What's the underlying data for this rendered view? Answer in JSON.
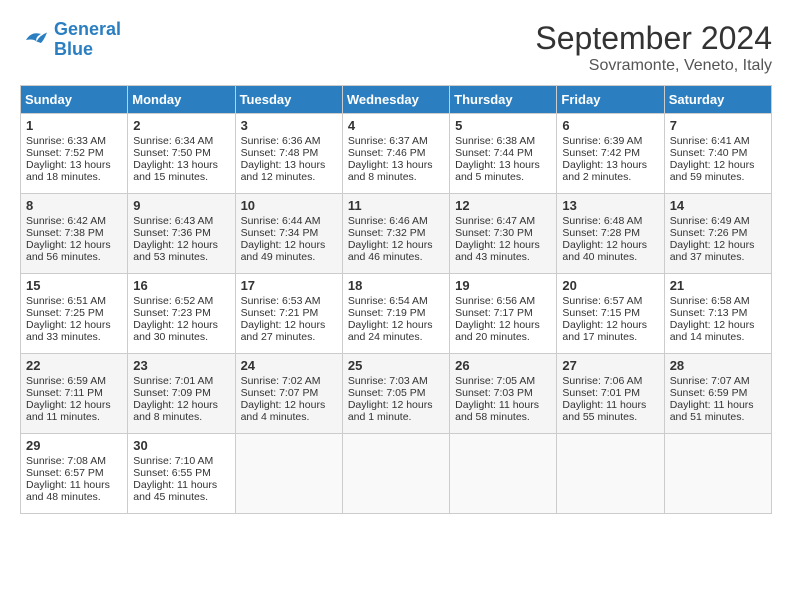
{
  "header": {
    "logo_line1": "General",
    "logo_line2": "Blue",
    "month": "September 2024",
    "location": "Sovramonte, Veneto, Italy"
  },
  "days_of_week": [
    "Sunday",
    "Monday",
    "Tuesday",
    "Wednesday",
    "Thursday",
    "Friday",
    "Saturday"
  ],
  "weeks": [
    [
      {
        "day": 1,
        "sunrise": "6:33 AM",
        "sunset": "7:52 PM",
        "daylight": "13 hours and 18 minutes."
      },
      {
        "day": 2,
        "sunrise": "6:34 AM",
        "sunset": "7:50 PM",
        "daylight": "13 hours and 15 minutes."
      },
      {
        "day": 3,
        "sunrise": "6:36 AM",
        "sunset": "7:48 PM",
        "daylight": "13 hours and 12 minutes."
      },
      {
        "day": 4,
        "sunrise": "6:37 AM",
        "sunset": "7:46 PM",
        "daylight": "13 hours and 8 minutes."
      },
      {
        "day": 5,
        "sunrise": "6:38 AM",
        "sunset": "7:44 PM",
        "daylight": "13 hours and 5 minutes."
      },
      {
        "day": 6,
        "sunrise": "6:39 AM",
        "sunset": "7:42 PM",
        "daylight": "13 hours and 2 minutes."
      },
      {
        "day": 7,
        "sunrise": "6:41 AM",
        "sunset": "7:40 PM",
        "daylight": "12 hours and 59 minutes."
      }
    ],
    [
      {
        "day": 8,
        "sunrise": "6:42 AM",
        "sunset": "7:38 PM",
        "daylight": "12 hours and 56 minutes."
      },
      {
        "day": 9,
        "sunrise": "6:43 AM",
        "sunset": "7:36 PM",
        "daylight": "12 hours and 53 minutes."
      },
      {
        "day": 10,
        "sunrise": "6:44 AM",
        "sunset": "7:34 PM",
        "daylight": "12 hours and 49 minutes."
      },
      {
        "day": 11,
        "sunrise": "6:46 AM",
        "sunset": "7:32 PM",
        "daylight": "12 hours and 46 minutes."
      },
      {
        "day": 12,
        "sunrise": "6:47 AM",
        "sunset": "7:30 PM",
        "daylight": "12 hours and 43 minutes."
      },
      {
        "day": 13,
        "sunrise": "6:48 AM",
        "sunset": "7:28 PM",
        "daylight": "12 hours and 40 minutes."
      },
      {
        "day": 14,
        "sunrise": "6:49 AM",
        "sunset": "7:26 PM",
        "daylight": "12 hours and 37 minutes."
      }
    ],
    [
      {
        "day": 15,
        "sunrise": "6:51 AM",
        "sunset": "7:25 PM",
        "daylight": "12 hours and 33 minutes."
      },
      {
        "day": 16,
        "sunrise": "6:52 AM",
        "sunset": "7:23 PM",
        "daylight": "12 hours and 30 minutes."
      },
      {
        "day": 17,
        "sunrise": "6:53 AM",
        "sunset": "7:21 PM",
        "daylight": "12 hours and 27 minutes."
      },
      {
        "day": 18,
        "sunrise": "6:54 AM",
        "sunset": "7:19 PM",
        "daylight": "12 hours and 24 minutes."
      },
      {
        "day": 19,
        "sunrise": "6:56 AM",
        "sunset": "7:17 PM",
        "daylight": "12 hours and 20 minutes."
      },
      {
        "day": 20,
        "sunrise": "6:57 AM",
        "sunset": "7:15 PM",
        "daylight": "12 hours and 17 minutes."
      },
      {
        "day": 21,
        "sunrise": "6:58 AM",
        "sunset": "7:13 PM",
        "daylight": "12 hours and 14 minutes."
      }
    ],
    [
      {
        "day": 22,
        "sunrise": "6:59 AM",
        "sunset": "7:11 PM",
        "daylight": "12 hours and 11 minutes."
      },
      {
        "day": 23,
        "sunrise": "7:01 AM",
        "sunset": "7:09 PM",
        "daylight": "12 hours and 8 minutes."
      },
      {
        "day": 24,
        "sunrise": "7:02 AM",
        "sunset": "7:07 PM",
        "daylight": "12 hours and 4 minutes."
      },
      {
        "day": 25,
        "sunrise": "7:03 AM",
        "sunset": "7:05 PM",
        "daylight": "12 hours and 1 minute."
      },
      {
        "day": 26,
        "sunrise": "7:05 AM",
        "sunset": "7:03 PM",
        "daylight": "11 hours and 58 minutes."
      },
      {
        "day": 27,
        "sunrise": "7:06 AM",
        "sunset": "7:01 PM",
        "daylight": "11 hours and 55 minutes."
      },
      {
        "day": 28,
        "sunrise": "7:07 AM",
        "sunset": "6:59 PM",
        "daylight": "11 hours and 51 minutes."
      }
    ],
    [
      {
        "day": 29,
        "sunrise": "7:08 AM",
        "sunset": "6:57 PM",
        "daylight": "11 hours and 48 minutes."
      },
      {
        "day": 30,
        "sunrise": "7:10 AM",
        "sunset": "6:55 PM",
        "daylight": "11 hours and 45 minutes."
      },
      null,
      null,
      null,
      null,
      null
    ]
  ]
}
